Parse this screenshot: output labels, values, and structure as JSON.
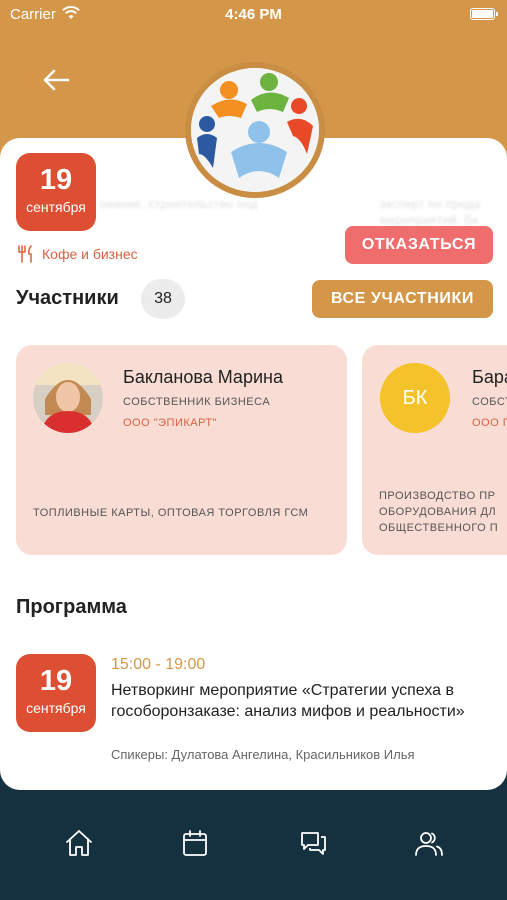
{
  "status_bar": {
    "carrier": "Carrier",
    "time": "4:46 PM"
  },
  "event": {
    "date": {
      "day": "19",
      "month": "сентября"
    },
    "category": "Кофе и бизнес",
    "decline_label": "ОТКАЗАТЬСЯ",
    "ghost_text_left": "ование, строительство под",
    "ghost_text_right_1": "эксперт по прода",
    "ghost_text_right_2": "мероприятий, би"
  },
  "participants": {
    "title": "Участники",
    "count": "38",
    "all_label": "ВСЕ УЧАСТНИКИ",
    "items": [
      {
        "name": "Бакланова Марина",
        "role": "СОБСТВЕННИК БИЗНЕСА",
        "company": "ООО \"ЭПИКАРТ\"",
        "description": "ТОПЛИВНЫЕ КАРТЫ, ОПТОВАЯ ТОРГОВЛЯ ГСМ"
      },
      {
        "initials": "БК",
        "name": "Бара",
        "role": "СОБСТ",
        "company": "ООО Г",
        "description": "ПРОИЗВОДСТВО ПР\nОБОРУДОВАНИЯ ДЛ\nОБЩЕСТВЕННОГО П"
      }
    ]
  },
  "program": {
    "title": "Программа",
    "items": [
      {
        "day": "19",
        "month": "сентября",
        "time": "15:00 - 19:00",
        "title": "Нетворкинг мероприятие «Стратегии успеха в гособоронзаказе: анализ мифов и реальности»",
        "speakers": "Спикеры: Дулатова Ангелина, Красильников Илья"
      }
    ]
  },
  "tabbar": {
    "icons": [
      "home-icon",
      "calendar-icon",
      "chat-icon",
      "people-icon"
    ]
  },
  "colors": {
    "header": "#d4974a",
    "accent_red": "#dc4f33",
    "decline": "#f06d6d",
    "card_pink": "#f9ddd5",
    "tabbar": "#15303f",
    "initials_avatar": "#f4c22b"
  }
}
